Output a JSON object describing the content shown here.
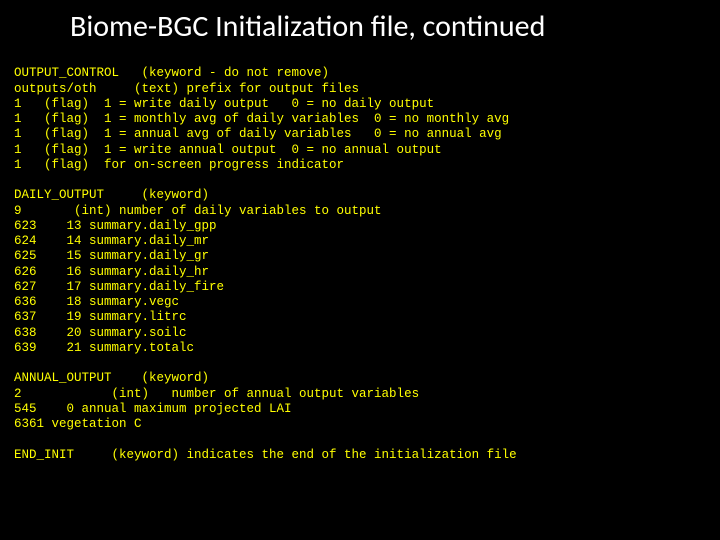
{
  "title": "Biome-BGC Initialization file, continued",
  "block1": {
    "l0": "OUTPUT_CONTROL   (keyword - do not remove)",
    "l1": "outputs/oth     (text) prefix for output files",
    "l2": "1   (flag)  1 = write daily output   0 = no daily output",
    "l3": "1   (flag)  1 = monthly avg of daily variables  0 = no monthly avg",
    "l4": "1   (flag)  1 = annual avg of daily variables   0 = no annual avg",
    "l5": "1   (flag)  1 = write annual output  0 = no annual output",
    "l6": "1   (flag)  for on-screen progress indicator"
  },
  "block2": {
    "l0": "DAILY_OUTPUT     (keyword)",
    "l1": "9       (int) number of daily variables to output",
    "l2": "623    13 summary.daily_gpp",
    "l3": "624    14 summary.daily_mr",
    "l4": "625    15 summary.daily_gr",
    "l5": "626    16 summary.daily_hr",
    "l6": "627    17 summary.daily_fire",
    "l7": "636    18 summary.vegc",
    "l8": "637    19 summary.litrc",
    "l9": "638    20 summary.soilc",
    "l10": "639    21 summary.totalc"
  },
  "block3": {
    "l0": "ANNUAL_OUTPUT    (keyword)",
    "l1": "2            (int)   number of annual output variables",
    "l2": "545    0 annual maximum projected LAI",
    "l3": "6361 vegetation C"
  },
  "block4": {
    "l0": "END_INIT     (keyword) indicates the end of the initialization file"
  }
}
